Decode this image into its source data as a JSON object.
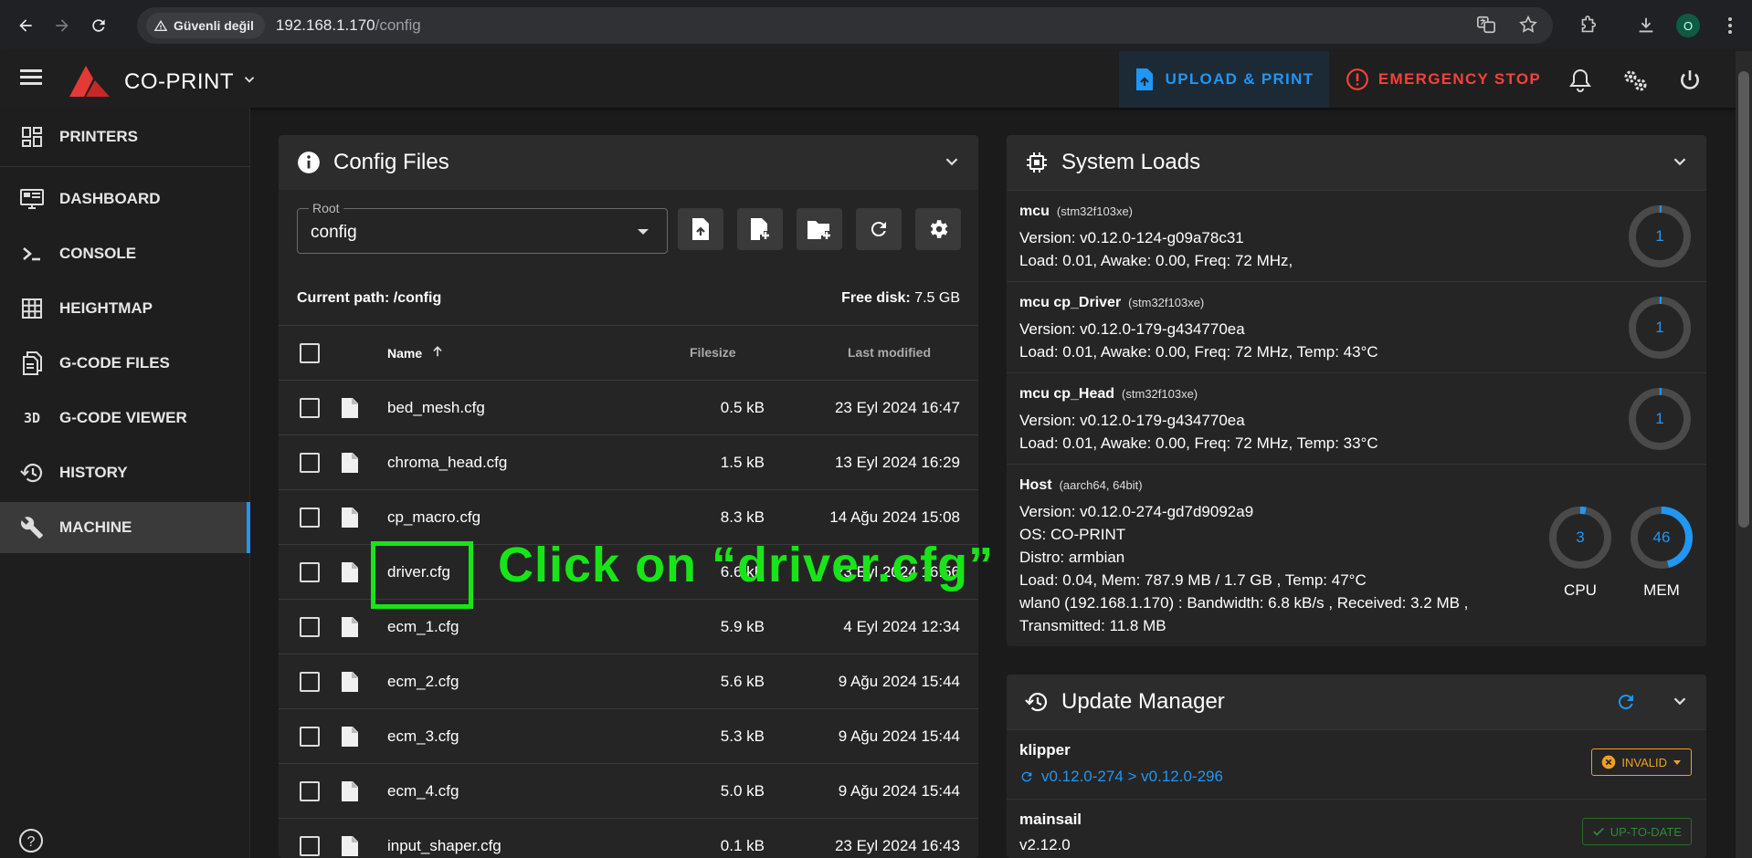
{
  "browser": {
    "security_label": "Güvenli değil",
    "url_host": "192.168.1.170",
    "url_path": "/config",
    "profile_initial": "O"
  },
  "appbar": {
    "brand": "CO-PRINT",
    "upload_label": "UPLOAD & PRINT",
    "estop_label": "EMERGENCY STOP"
  },
  "sidebar": {
    "items": [
      {
        "label": "PRINTERS",
        "icon": "grid-dashboard-icon"
      },
      {
        "label": "DASHBOARD",
        "icon": "monitor-dashboard-icon"
      },
      {
        "label": "CONSOLE",
        "icon": "console-prompt-icon"
      },
      {
        "label": "HEIGHTMAP",
        "icon": "grid-icon"
      },
      {
        "label": "G-CODE FILES",
        "icon": "file-document-icon"
      },
      {
        "label": "G-CODE VIEWER",
        "icon": "3d-icon"
      },
      {
        "label": "HISTORY",
        "icon": "history-icon"
      },
      {
        "label": "MACHINE",
        "icon": "wrench-icon"
      }
    ],
    "cube_glyph": "3D",
    "help_glyph": "?"
  },
  "config": {
    "title": "Config Files",
    "root_label": "Root",
    "root_value": "config",
    "current_path_label": "Current path: /config",
    "free_disk_label": "Free disk:",
    "free_disk_value": "7.5 GB",
    "columns": {
      "name": "Name",
      "size": "Filesize",
      "modified": "Last modified"
    },
    "files": [
      {
        "name": "bed_mesh.cfg",
        "size": "0.5 kB",
        "modified": "23 Eyl 2024 16:47"
      },
      {
        "name": "chroma_head.cfg",
        "size": "1.5 kB",
        "modified": "13 Eyl 2024 16:29"
      },
      {
        "name": "cp_macro.cfg",
        "size": "8.3 kB",
        "modified": "14 Ağu 2024 15:08"
      },
      {
        "name": "driver.cfg",
        "size": "6.6 kB",
        "modified": "23 Eyl 2024 16:56"
      },
      {
        "name": "ecm_1.cfg",
        "size": "5.9 kB",
        "modified": "4 Eyl 2024 12:34"
      },
      {
        "name": "ecm_2.cfg",
        "size": "5.6 kB",
        "modified": "9 Ağu 2024 15:44"
      },
      {
        "name": "ecm_3.cfg",
        "size": "5.3 kB",
        "modified": "9 Ağu 2024 15:44"
      },
      {
        "name": "ecm_4.cfg",
        "size": "5.0 kB",
        "modified": "9 Ağu 2024 15:44"
      },
      {
        "name": "input_shaper.cfg",
        "size": "0.1 kB",
        "modified": "23 Eyl 2024 16:43"
      }
    ]
  },
  "annotation": {
    "callout": "Click on “driver.cfg”",
    "color": "#18e518"
  },
  "system": {
    "title": "System Loads",
    "mcus": [
      {
        "name": "mcu",
        "chip": "(stm32f103xe)",
        "version": "Version: v0.12.0-124-g09a78c31",
        "load": "Load: 0.01, Awake: 0.00, Freq: 72 MHz,",
        "gauge": "1"
      },
      {
        "name": "mcu cp_Driver",
        "chip": "(stm32f103xe)",
        "version": "Version: v0.12.0-179-g434770ea",
        "load": "Load: 0.01, Awake: 0.00, Freq: 72 MHz, Temp: 43°C",
        "gauge": "1"
      },
      {
        "name": "mcu cp_Head",
        "chip": "(stm32f103xe)",
        "version": "Version: v0.12.0-179-g434770ea",
        "load": "Load: 0.01, Awake: 0.00, Freq: 72 MHz, Temp: 33°C",
        "gauge": "1"
      }
    ],
    "host": {
      "name": "Host",
      "arch": "(aarch64, 64bit)",
      "lines": [
        "Version: v0.12.0-274-gd7d9092a9",
        "OS: CO-PRINT",
        "Distro: armbian",
        "Load: 0.04, Mem: 787.9 MB / 1.7 GB , Temp: 47°C",
        "wlan0 (192.168.1.170) : Bandwidth: 6.8 kB/s , Received: 3.2 MB ,",
        "Transmitted: 11.8 MB"
      ],
      "cpu_value": "3",
      "cpu_label": "CPU",
      "mem_value": "46",
      "mem_label": "MEM"
    }
  },
  "update": {
    "title": "Update Manager",
    "items": [
      {
        "name": "klipper",
        "version": "v0.12.0-274 > v0.12.0-296",
        "badge": "INVALID"
      },
      {
        "name": "mainsail",
        "version": "v2.12.0",
        "badge": "UP-TO-DATE"
      }
    ]
  },
  "colors": {
    "accent": "#2196f3",
    "danger": "#f44336",
    "warning": "#f0a020",
    "success": "#2b8b3b"
  }
}
